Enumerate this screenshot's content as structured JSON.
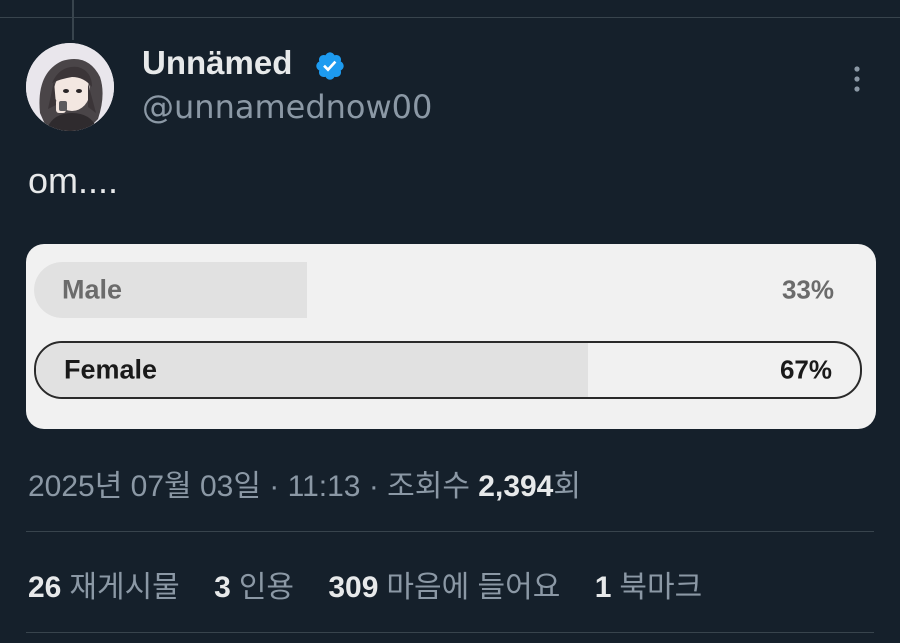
{
  "author": {
    "display_name": "Unnämed",
    "handle": "@unnamednow00",
    "verified": true,
    "verified_color": "#1d9bf0",
    "avatar_icon": "anime-avatar-icon"
  },
  "tweet": {
    "text": "om...."
  },
  "poll": {
    "options": [
      {
        "label": "Male",
        "percent_text": "33%",
        "percent": 33
      },
      {
        "label": "Female",
        "percent_text": "67%",
        "percent": 67,
        "selected": true
      }
    ]
  },
  "meta": {
    "date": "2025년 07월 03일",
    "sep1": " · ",
    "time": "11:13",
    "sep2": " · ",
    "views_label": "조회수 ",
    "views_count": "2,394",
    "views_suffix": "회"
  },
  "stats": [
    {
      "count": "26",
      "label": "재게시물"
    },
    {
      "count": "3",
      "label": "인용"
    },
    {
      "count": "309",
      "label": "마음에 들어요"
    },
    {
      "count": "1",
      "label": "북마크"
    }
  ],
  "colors": {
    "background": "#15202b",
    "divider": "#38444d",
    "secondary_text": "#8b98a5"
  }
}
